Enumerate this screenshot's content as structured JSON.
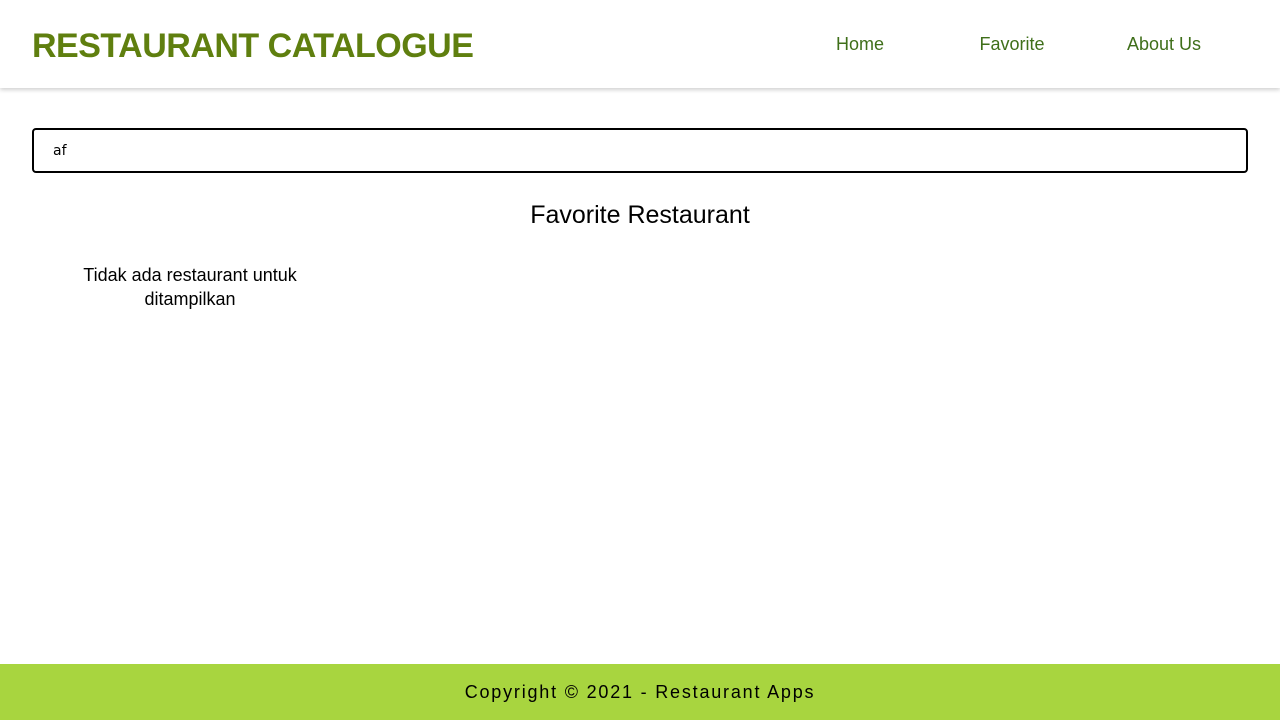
{
  "header": {
    "brand": "RESTAURANT CATALOGUE",
    "nav": [
      {
        "label": "Home"
      },
      {
        "label": "Favorite"
      },
      {
        "label": "About Us"
      }
    ]
  },
  "search": {
    "value": "af",
    "placeholder": ""
  },
  "main": {
    "title": "Favorite Restaurant",
    "empty_message": "Tidak ada restaurant untuk ditampilkan"
  },
  "footer": {
    "copyright": "Copyright © 2021 - Restaurant Apps"
  },
  "colors": {
    "brand": "#5f7f0f",
    "nav_link": "#3f6f1a",
    "footer_bg": "#a8d53f"
  }
}
